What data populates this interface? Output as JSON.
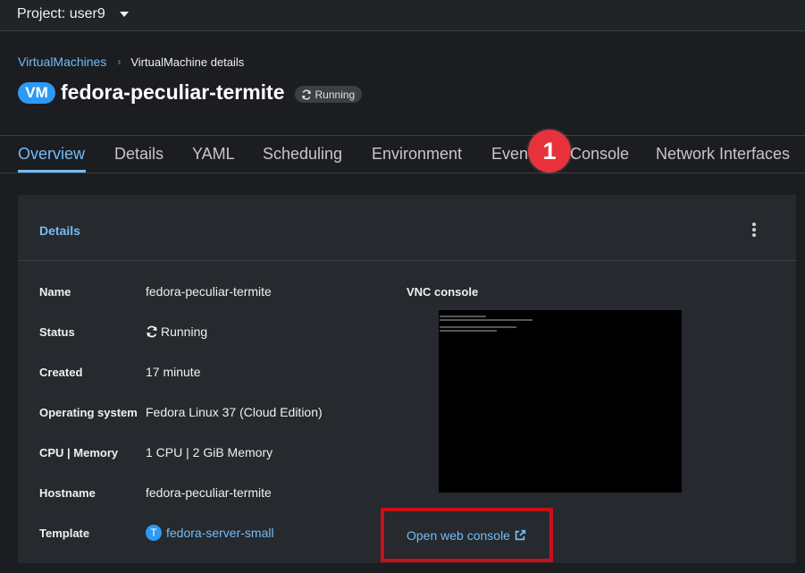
{
  "project": {
    "label": "Project: user9"
  },
  "breadcrumb": {
    "parent": "VirtualMachines",
    "current": "VirtualMachine details"
  },
  "header": {
    "badge": "VM",
    "title": "fedora-peculiar-termite",
    "status": "Running"
  },
  "tabs": [
    {
      "label": "Overview",
      "active": true
    },
    {
      "label": "Details"
    },
    {
      "label": "YAML"
    },
    {
      "label": "Scheduling"
    },
    {
      "label": "Environment"
    },
    {
      "label": "Events"
    },
    {
      "label": "Console"
    },
    {
      "label": "Network Interfaces"
    }
  ],
  "callout": {
    "number": "1"
  },
  "card": {
    "title": "Details",
    "rows": [
      {
        "label": "Name",
        "value": "fedora-peculiar-termite"
      },
      {
        "label": "Status",
        "value": "Running"
      },
      {
        "label": "Created",
        "value": "17 minute"
      },
      {
        "label": "Operating system",
        "value": "Fedora Linux 37 (Cloud Edition)"
      },
      {
        "label": "CPU | Memory",
        "value": "1 CPU | 2 GiB Memory"
      },
      {
        "label": "Hostname",
        "value": "fedora-peculiar-termite"
      },
      {
        "label": "Template",
        "value": "fedora-server-small",
        "icon_letter": "T"
      }
    ],
    "vnc_label": "VNC console",
    "open_console": "Open web console"
  },
  "colors": {
    "accent": "#73bcf7",
    "badge": "#2b9af3",
    "callout": "#e8323b",
    "highlight": "#c8101a"
  }
}
